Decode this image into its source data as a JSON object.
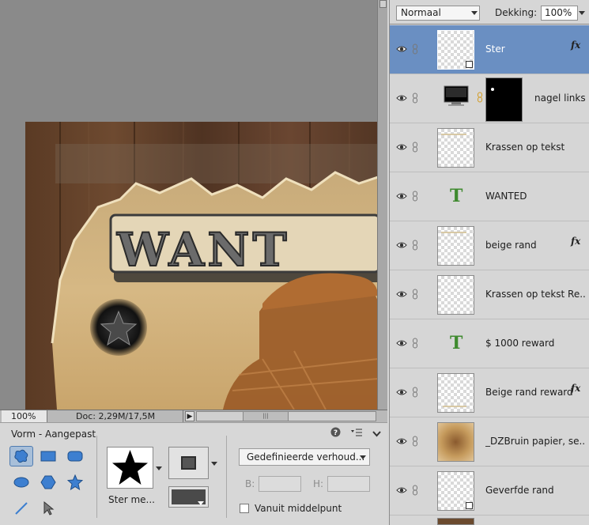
{
  "status": {
    "zoom": "100%",
    "doc": "Doc: 2,29M/17,5M"
  },
  "artwork": {
    "poster_word": "WANT"
  },
  "tool_options": {
    "title": "Vorm - Aangepast",
    "shape_label": "Ster me...",
    "style_combo": "Gedefinieerde verhoud...",
    "b_label": "B:",
    "h_label": "H:",
    "center_checkbox_label": "Vanuit middelpunt",
    "icons": [
      "help-icon",
      "panel-menu-icon",
      "collapse-chevron-icon"
    ],
    "tools": [
      "custom-shape",
      "rectangle",
      "rounded-rectangle",
      "ellipse",
      "polygon",
      "star",
      "line",
      "selection-arrow"
    ],
    "selected_tool": "custom-shape",
    "selected_color": "#4a4a4a"
  },
  "layers_panel": {
    "blend_mode": "Normaal",
    "opacity_label": "Dekking:",
    "opacity_value": "100%",
    "layers": [
      {
        "name": "Ster",
        "fx": "fx",
        "selected": true
      },
      {
        "name": "nagel links",
        "fx": "",
        "selected": false
      },
      {
        "name": "Krassen op tekst",
        "fx": "",
        "selected": false
      },
      {
        "name": "WANTED",
        "fx": "",
        "selected": false
      },
      {
        "name": "beige rand",
        "fx": "fx",
        "selected": false
      },
      {
        "name": "Krassen op tekst Re...",
        "fx": "",
        "selected": false
      },
      {
        "name": "$ 1000 reward",
        "fx": "",
        "selected": false
      },
      {
        "name": "Beige rand reward",
        "fx": "fx",
        "selected": false
      },
      {
        "name": "_DZBruin papier, se...",
        "fx": "",
        "selected": false
      },
      {
        "name": "Geverfde rand",
        "fx": "",
        "selected": false
      }
    ],
    "text_layer_glyph": "T"
  },
  "colors": {
    "selection": "#6a8fc2",
    "text_layer": "#3f8a2f"
  }
}
